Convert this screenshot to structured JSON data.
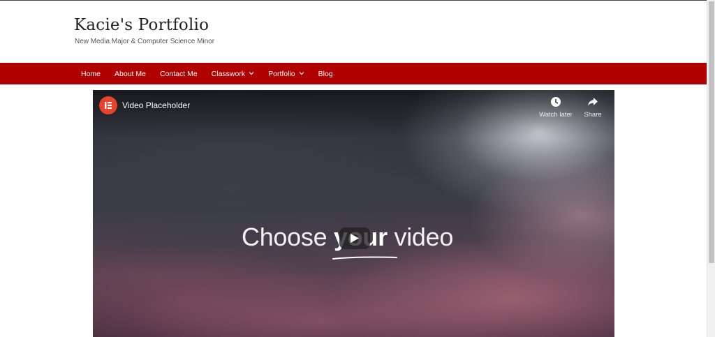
{
  "site": {
    "title": "Kacie's Portfolio",
    "tagline": "New Media Major & Computer Science Minor"
  },
  "nav": {
    "items": [
      {
        "label": "Home",
        "has_dropdown": false
      },
      {
        "label": "About Me",
        "has_dropdown": false
      },
      {
        "label": "Contact Me",
        "has_dropdown": false
      },
      {
        "label": "Classwork",
        "has_dropdown": true
      },
      {
        "label": "Portfolio",
        "has_dropdown": true
      },
      {
        "label": "Blog",
        "has_dropdown": false
      }
    ]
  },
  "video": {
    "title": "Video Placeholder",
    "channel_icon": "elementor-logo-icon",
    "watch_later_label": "Watch later",
    "share_label": "Share",
    "headline_before": "Choose ",
    "headline_bold": "your",
    "headline_after": " video",
    "play_icon": "play-icon"
  },
  "colors": {
    "nav_background": "#b00000",
    "channel_logo": "#e8442c"
  }
}
